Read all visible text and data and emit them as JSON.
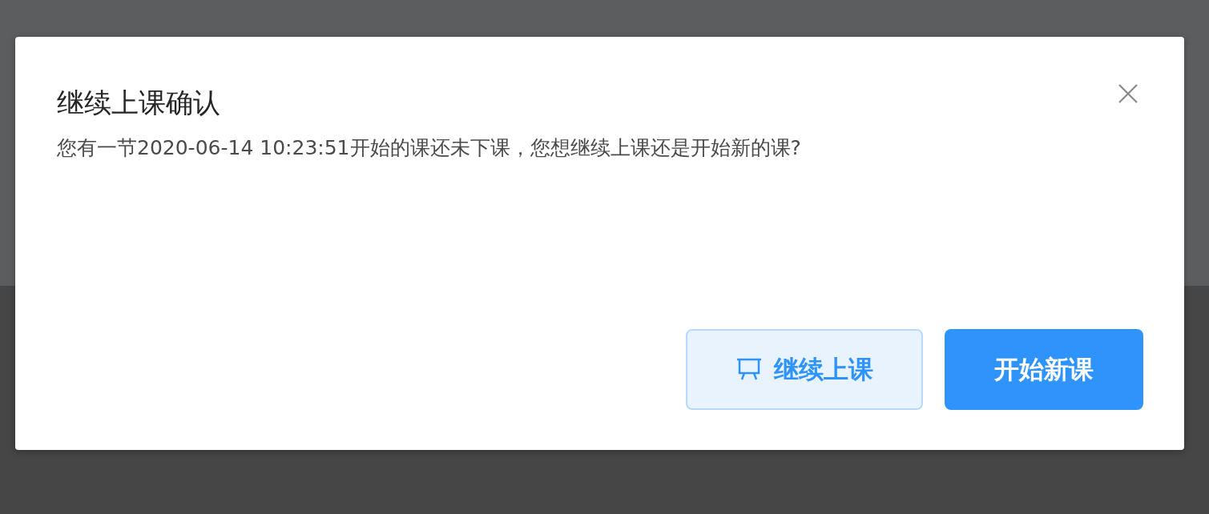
{
  "dialog": {
    "title": "继续上课确认",
    "message": "您有一节2020-06-14 10:23:51开始的课还未下课，您想继续上课还是开始新的课?",
    "buttons": [
      {
        "label": "继续上课",
        "kind": "secondary"
      },
      {
        "label": "开始新课",
        "kind": "primary"
      }
    ]
  }
}
